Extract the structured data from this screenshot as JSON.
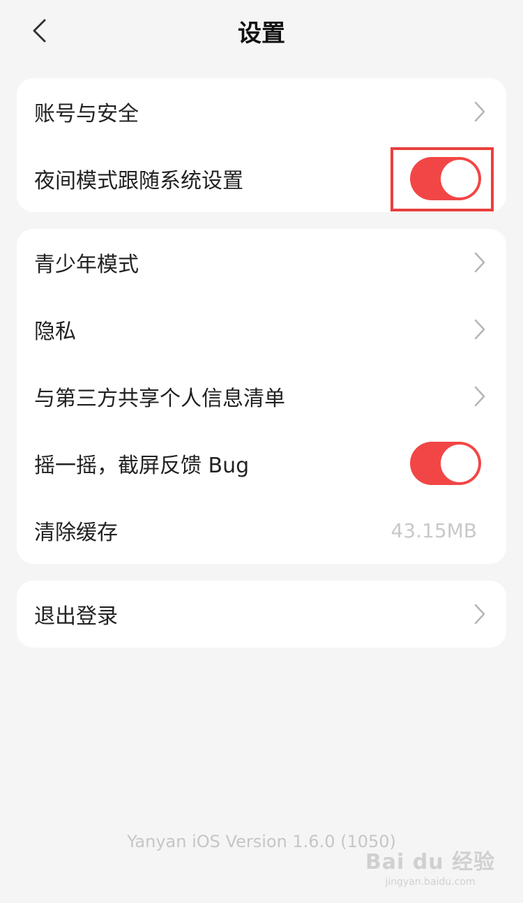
{
  "header": {
    "title": "设置",
    "back_icon": "chevron-left-icon"
  },
  "group1": {
    "account_security": {
      "label": "账号与安全"
    },
    "night_mode": {
      "label": "夜间模式跟随系统设置",
      "enabled": true
    }
  },
  "group2": {
    "teen_mode": {
      "label": "青少年模式"
    },
    "privacy": {
      "label": "隐私"
    },
    "third_party": {
      "label": "与第三方共享个人信息清单"
    },
    "shake_feedback": {
      "label": "摇一摇，截屏反馈 Bug",
      "enabled": true
    },
    "clear_cache": {
      "label": "清除缓存",
      "value": "43.15MB"
    }
  },
  "group3": {
    "logout": {
      "label": "退出登录"
    }
  },
  "footer": {
    "version": "Yanyan iOS Version 1.6.0 (1050)"
  },
  "watermark": {
    "main": "Bai du 经验",
    "sub": "jingyan.baidu.com"
  },
  "colors": {
    "accent": "#f24646",
    "background": "#f5f5f5",
    "card": "#ffffff",
    "highlight": "#e8403e"
  }
}
